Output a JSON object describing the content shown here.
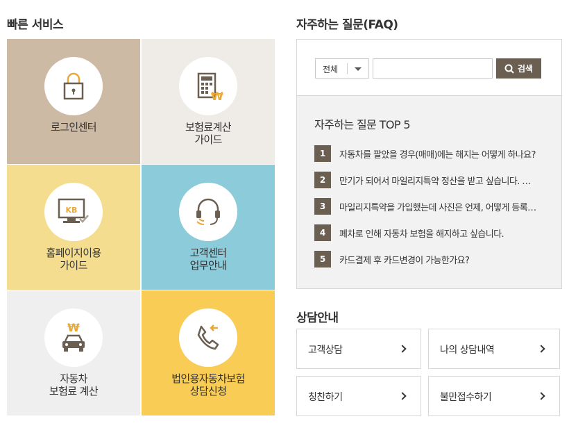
{
  "quick_service": {
    "title": "빠른 서비스",
    "tiles": [
      {
        "label": "로그인센터",
        "bg": "#cdbaa4",
        "icon": "lock-icon"
      },
      {
        "label": "보험료계산\n가이드",
        "bg": "#efece8",
        "icon": "calculator-icon"
      },
      {
        "label": "홈페이지이용\n가이드",
        "bg": "#f5dd8f",
        "icon": "kb-monitor-icon"
      },
      {
        "label": "고객센터\n업무안내",
        "bg": "#8ccbd9",
        "icon": "headset-icon"
      },
      {
        "label": "자동차\n보험료 계산",
        "bg": "#efefef",
        "icon": "car-won-icon"
      },
      {
        "label": "법인용자동차보험\n상담신청",
        "bg": "#f8cc55",
        "icon": "phone-icon"
      }
    ]
  },
  "faq": {
    "title": "자주하는 질문(FAQ)",
    "select_value": "전체",
    "search_placeholder": "",
    "search_button": "검색",
    "top_title": "자주하는 질문 TOP 5",
    "items": [
      {
        "num": "1",
        "q": "자동차를 팔았을 경우(매매)에는 해지는 어떻게 하나요?"
      },
      {
        "num": "2",
        "q": "만기가 되어서 마일리지특약 정산을 받고 싶습니다. …"
      },
      {
        "num": "3",
        "q": "마일리지특약을 가입했는데 사진은 언제, 어떻게 등록…"
      },
      {
        "num": "4",
        "q": "폐차로 인해 자동차 보험을 해지하고 싶습니다."
      },
      {
        "num": "5",
        "q": "카드결제 후 카드변경이 가능한가요?"
      }
    ]
  },
  "consult": {
    "title": "상담안내",
    "buttons": [
      {
        "label": "고객상담"
      },
      {
        "label": "나의 상담내역"
      },
      {
        "label": "칭찬하기"
      },
      {
        "label": "불만접수하기"
      }
    ]
  },
  "colors": {
    "brown": "#6b5f52",
    "gold": "#e8a93a"
  }
}
